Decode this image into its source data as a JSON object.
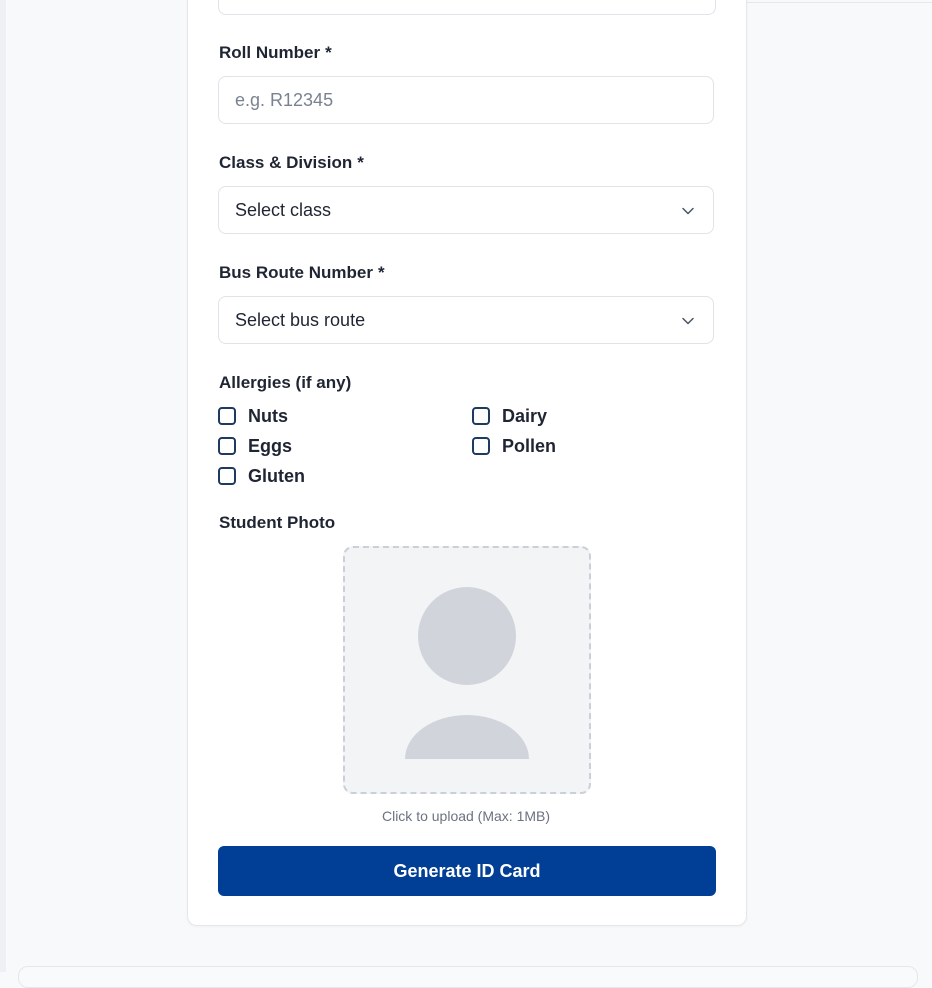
{
  "form": {
    "roll": {
      "label": "Roll Number",
      "required_mark": "*",
      "placeholder": "e.g. R12345"
    },
    "class_division": {
      "label": "Class & Division",
      "required_mark": "*",
      "selected": "Select class"
    },
    "bus_route": {
      "label": "Bus Route Number",
      "required_mark": "*",
      "selected": "Select bus route"
    },
    "allergies": {
      "label": "Allergies (if any)",
      "options": [
        "Nuts",
        "Dairy",
        "Eggs",
        "Pollen",
        "Gluten"
      ]
    },
    "photo": {
      "label": "Student Photo",
      "hint": "Click to upload (Max: 1MB)"
    },
    "submit_label": "Generate ID Card"
  },
  "icons": {
    "select_chevron": "chevron-down-icon",
    "photo_placeholder": "avatar-placeholder-icon"
  },
  "colors": {
    "primary": "#003f95",
    "checkbox_border": "#1f3a5f",
    "placeholder_bg": "#f3f4f6",
    "placeholder_shape": "#d1d5db"
  }
}
